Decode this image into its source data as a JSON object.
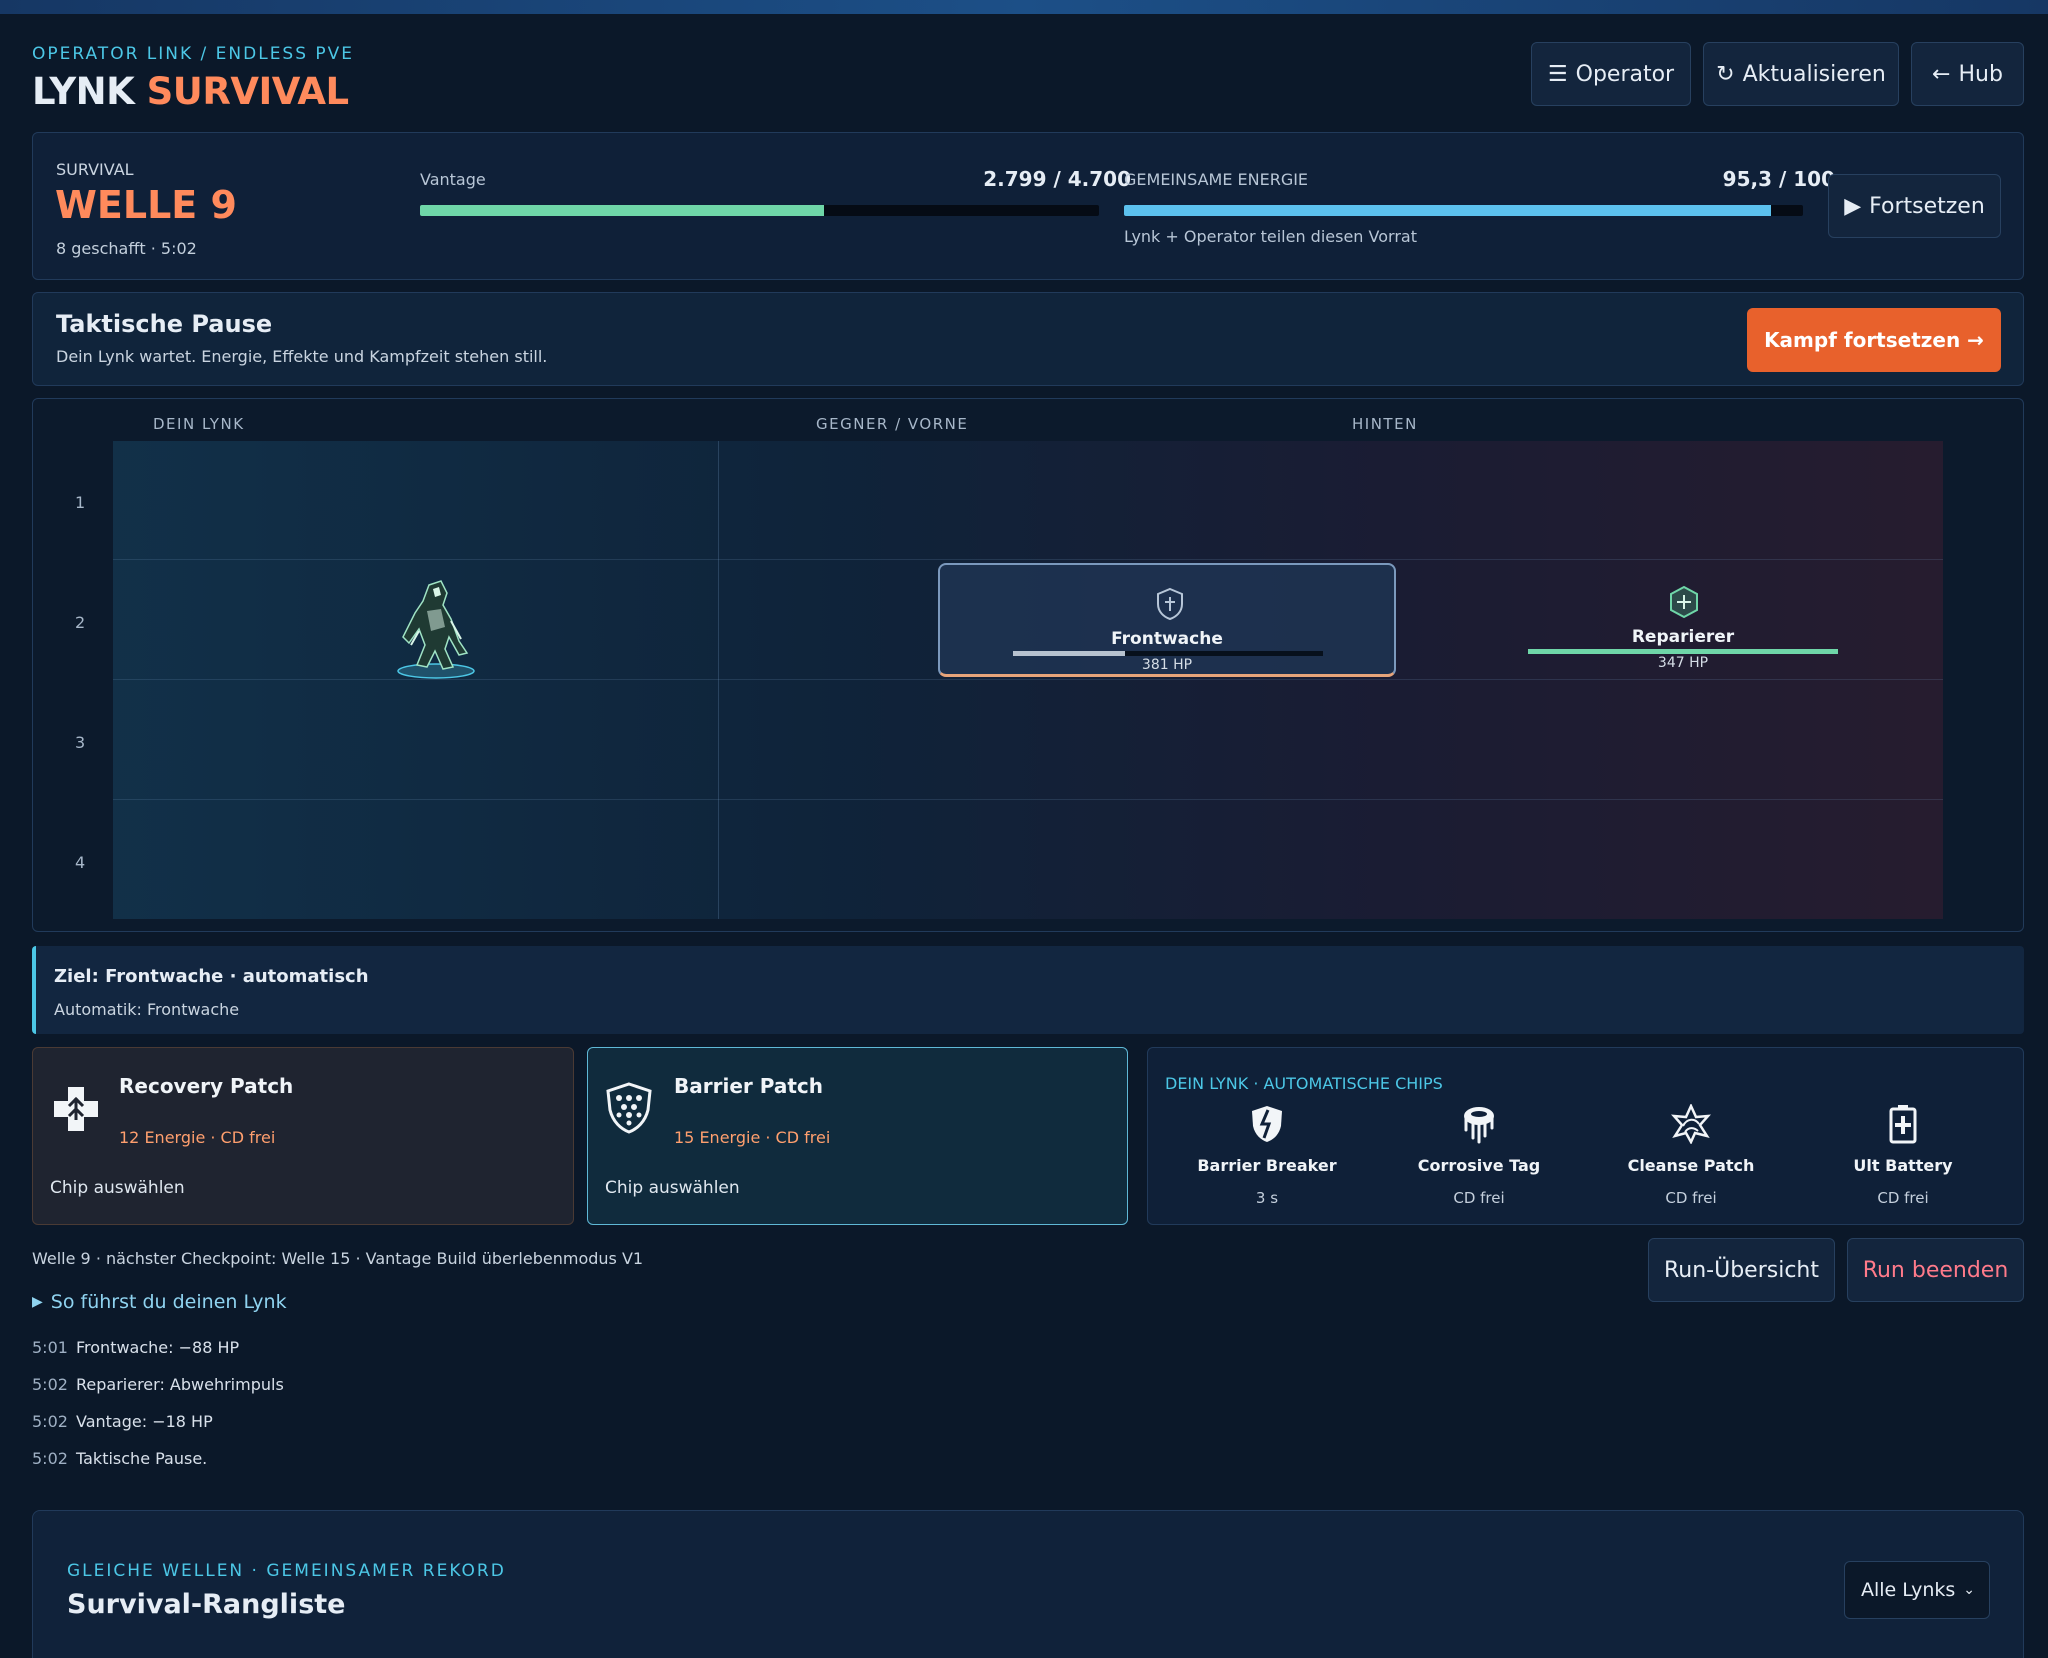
{
  "header": {
    "kicker": "OPERATOR LINK / ENDLESS PVE",
    "title_main": "LYNK",
    "title_accent": "SURVIVAL",
    "buttons": {
      "operator": "Operator",
      "refresh": "Aktualisieren",
      "hub": "Hub"
    }
  },
  "status": {
    "mode": "SURVIVAL",
    "wave": "WELLE 9",
    "meta": "8 geschafft · 5:02",
    "vantage": {
      "label": "Vantage",
      "value": "2.799 / 4.700",
      "fraction": 0.5955
    },
    "energy": {
      "label": "GEMEINSAME ENERGIE",
      "value": "95,3 / 100",
      "fraction": 0.953,
      "note": "Lynk + Operator teilen diesen Vorrat"
    },
    "continue_label": "Fortsetzen"
  },
  "pause": {
    "title": "Taktische Pause",
    "subtitle": "Dein Lynk wartet. Energie, Effekte und Kampfzeit stehen still.",
    "resume_label": "Kampf fortsetzen →"
  },
  "field": {
    "columns": [
      "DEIN LYNK",
      "GEGNER / VORNE",
      "HINTEN"
    ],
    "rows": [
      "1",
      "2",
      "3",
      "4"
    ],
    "enemies": [
      {
        "name": "Frontwache",
        "hp": "381 HP",
        "hp_fraction": 0.36
      },
      {
        "name": "Reparierer",
        "hp": "347 HP",
        "hp_fraction": 1.0
      }
    ]
  },
  "target": {
    "title": "Ziel: Frontwache · automatisch",
    "sub": "Automatik: Frontwache"
  },
  "chips": [
    {
      "name": "Recovery Patch",
      "cost": "12 Energie · CD frei",
      "action": "Chip auswählen"
    },
    {
      "name": "Barrier Patch",
      "cost": "15 Energie · CD frei",
      "action": "Chip auswählen"
    }
  ],
  "auto_chips": {
    "heading": "DEIN LYNK · AUTOMATISCHE CHIPS",
    "items": [
      {
        "name": "Barrier Breaker",
        "cd": "3 s"
      },
      {
        "name": "Corrosive Tag",
        "cd": "CD frei"
      },
      {
        "name": "Cleanse Patch",
        "cd": "CD frei"
      },
      {
        "name": "Ult Battery",
        "cd": "CD frei"
      }
    ]
  },
  "footer": {
    "info": "Welle 9 · nächster Checkpoint: Welle 15 · Vantage Build überlebenmodus V1",
    "guide": "So führst du deinen Lynk",
    "run_overview": "Run-Übersicht",
    "run_end": "Run beenden"
  },
  "log": [
    {
      "time": "5:01",
      "text": "Frontwache: −88 HP"
    },
    {
      "time": "5:02",
      "text": "Reparierer: Abwehrimpuls"
    },
    {
      "time": "5:02",
      "text": "Vantage: −18 HP"
    },
    {
      "time": "5:02",
      "text": "Taktische Pause."
    }
  ],
  "ranking": {
    "kicker": "GLEICHE WELLEN · GEMEINSAMER REKORD",
    "title": "Survival-Rangliste",
    "filter": "Alle Lynks"
  },
  "colors": {
    "accent_orange": "#ff8a5c",
    "vantage_green": "#6fd6a8",
    "energy_blue": "#5cc1ee",
    "resume_orange": "#e8612c"
  }
}
